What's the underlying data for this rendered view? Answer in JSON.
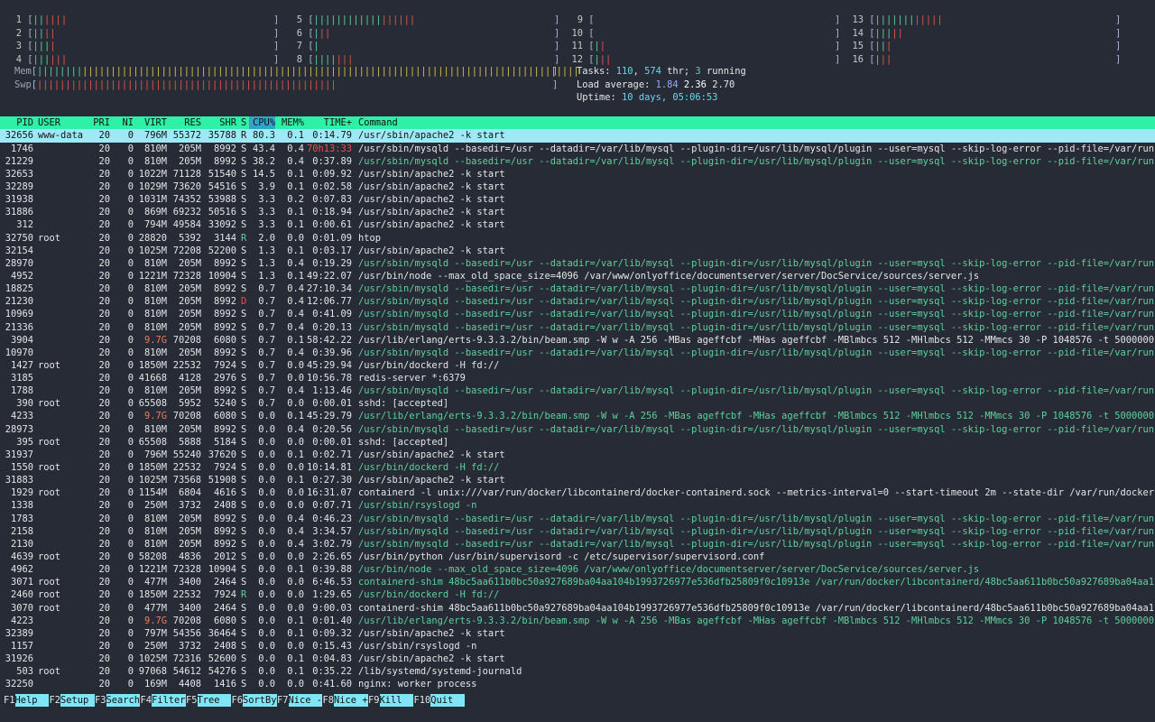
{
  "cpus": [
    {
      "id": "1",
      "green": "||",
      "red": "||||"
    },
    {
      "id": "2",
      "green": "||",
      "red": "||"
    },
    {
      "id": "3",
      "green": "|||",
      "red": "|"
    },
    {
      "id": "4",
      "green": "|||",
      "red": "|||"
    },
    {
      "id": "5",
      "green": "||||||||||||",
      "red": "||||||"
    },
    {
      "id": "6",
      "green": "|",
      "red": "||"
    },
    {
      "id": "7",
      "green": "|",
      "red": ""
    },
    {
      "id": "8",
      "green": "||||",
      "red": "|||"
    },
    {
      "id": "9",
      "green": "",
      "red": ""
    },
    {
      "id": "10",
      "green": "",
      "red": ""
    },
    {
      "id": "11",
      "green": "|",
      "red": "|"
    },
    {
      "id": "12",
      "green": "|",
      "red": "||"
    },
    {
      "id": "13",
      "green": "|||||||",
      "red": "|||||"
    },
    {
      "id": "14",
      "green": "|||",
      "red": "||"
    },
    {
      "id": "15",
      "green": "||",
      "red": "|"
    },
    {
      "id": "16",
      "green": "|",
      "red": "||"
    }
  ],
  "mem": {
    "label": "Mem",
    "green": "||||||||",
    "yellow": "||||||||||||||||||||||||||||||||||||||||||||||||||||||||||||||||||||||||||||||||||||||||"
  },
  "swp": {
    "label": "Swp",
    "red": "|||||||||||||||||||||||||||||||||||||||||||||||||||||"
  },
  "stats": {
    "tasks_label": "Tasks: ",
    "tasks": "110",
    "thr_sep": ", ",
    "thr": "574",
    "thr_label": " thr; ",
    "running": "3",
    "running_label": " running",
    "load_label": "Load average: ",
    "load1": "1.84",
    "load5": "2.36",
    "load15": "2.70",
    "uptime_label": "Uptime: ",
    "uptime": "10 days, 05:06:53"
  },
  "columns": {
    "pid": "PID",
    "user": "USER",
    "pri": "PRI",
    "ni": "NI",
    "virt": "VIRT",
    "res": "RES",
    "shr": "SHR",
    "s": "S",
    "cpu": "CPU%",
    "mem": "MEM%",
    "time": "TIME+",
    "cmd": "Command"
  },
  "processes": [
    {
      "pid": "32656",
      "user": "www-data",
      "pri": "20",
      "ni": "0",
      "virt": "796M",
      "res": "55372",
      "shr": "35788",
      "s": "R",
      "cpu": "80.3",
      "mem": "0.1",
      "time": "0:14.79",
      "cmd": "/usr/sbin/apache2 -k start",
      "sel": true
    },
    {
      "pid": "1746",
      "user": "",
      "pri": "20",
      "ni": "0",
      "virt": "810M",
      "res": "205M",
      "shr": "8992",
      "s": "S",
      "cpu": "43.4",
      "mem": "0.4",
      "time": "70h13:33",
      "cmd": "/usr/sbin/mysqld --basedir=/usr --datadir=/var/lib/mysql --plugin-dir=/usr/lib/mysql/plugin --user=mysql --skip-log-error --pid-file=/var/run"
    },
    {
      "pid": "21229",
      "user": "",
      "pri": "20",
      "ni": "0",
      "virt": "810M",
      "res": "205M",
      "shr": "8992",
      "s": "S",
      "cpu": "38.2",
      "mem": "0.4",
      "time": "0:37.89",
      "cmd": "/usr/sbin/mysqld --basedir=/usr --datadir=/var/lib/mysql --plugin-dir=/usr/lib/mysql/plugin --user=mysql --skip-log-error --pid-file=/var/run",
      "thread": true
    },
    {
      "pid": "32653",
      "user": "",
      "pri": "20",
      "ni": "0",
      "virt": "1022M",
      "res": "71128",
      "shr": "51540",
      "s": "S",
      "cpu": "14.5",
      "mem": "0.1",
      "time": "0:09.92",
      "cmd": "/usr/sbin/apache2 -k start"
    },
    {
      "pid": "32289",
      "user": "",
      "pri": "20",
      "ni": "0",
      "virt": "1029M",
      "res": "73620",
      "shr": "54516",
      "s": "S",
      "cpu": "3.9",
      "mem": "0.1",
      "time": "0:02.58",
      "cmd": "/usr/sbin/apache2 -k start"
    },
    {
      "pid": "31938",
      "user": "",
      "pri": "20",
      "ni": "0",
      "virt": "1031M",
      "res": "74352",
      "shr": "53988",
      "s": "S",
      "cpu": "3.3",
      "mem": "0.2",
      "time": "0:07.83",
      "cmd": "/usr/sbin/apache2 -k start"
    },
    {
      "pid": "31886",
      "user": "",
      "pri": "20",
      "ni": "0",
      "virt": "869M",
      "res": "69232",
      "shr": "50516",
      "s": "S",
      "cpu": "3.3",
      "mem": "0.1",
      "time": "0:18.94",
      "cmd": "/usr/sbin/apache2 -k start"
    },
    {
      "pid": "312",
      "user": "",
      "pri": "20",
      "ni": "0",
      "virt": "794M",
      "res": "49584",
      "shr": "33092",
      "s": "S",
      "cpu": "3.3",
      "mem": "0.1",
      "time": "0:00.61",
      "cmd": "/usr/sbin/apache2 -k start"
    },
    {
      "pid": "32750",
      "user": "root",
      "pri": "20",
      "ni": "0",
      "virt": "28820",
      "res": "5392",
      "shr": "3144",
      "s": "R",
      "cpu": "2.0",
      "mem": "0.0",
      "time": "0:01.09",
      "cmd": "htop"
    },
    {
      "pid": "32154",
      "user": "",
      "pri": "20",
      "ni": "0",
      "virt": "1025M",
      "res": "72208",
      "shr": "52200",
      "s": "S",
      "cpu": "1.3",
      "mem": "0.1",
      "time": "0:03.17",
      "cmd": "/usr/sbin/apache2 -k start"
    },
    {
      "pid": "28970",
      "user": "",
      "pri": "20",
      "ni": "0",
      "virt": "810M",
      "res": "205M",
      "shr": "8992",
      "s": "S",
      "cpu": "1.3",
      "mem": "0.4",
      "time": "0:19.29",
      "cmd": "/usr/sbin/mysqld --basedir=/usr --datadir=/var/lib/mysql --plugin-dir=/usr/lib/mysql/plugin --user=mysql --skip-log-error --pid-file=/var/run",
      "thread": true
    },
    {
      "pid": "4952",
      "user": "",
      "pri": "20",
      "ni": "0",
      "virt": "1221M",
      "res": "72328",
      "shr": "10904",
      "s": "S",
      "cpu": "1.3",
      "mem": "0.1",
      "time": "49:22.07",
      "cmd": "/usr/bin/node --max_old_space_size=4096 /var/www/onlyoffice/documentserver/server/DocService/sources/server.js"
    },
    {
      "pid": "18825",
      "user": "",
      "pri": "20",
      "ni": "0",
      "virt": "810M",
      "res": "205M",
      "shr": "8992",
      "s": "S",
      "cpu": "0.7",
      "mem": "0.4",
      "time": "27:10.34",
      "cmd": "/usr/sbin/mysqld --basedir=/usr --datadir=/var/lib/mysql --plugin-dir=/usr/lib/mysql/plugin --user=mysql --skip-log-error --pid-file=/var/run",
      "thread": true
    },
    {
      "pid": "21230",
      "user": "",
      "pri": "20",
      "ni": "0",
      "virt": "810M",
      "res": "205M",
      "shr": "8992",
      "s": "D",
      "cpu": "0.7",
      "mem": "0.4",
      "time": "12:06.77",
      "cmd": "/usr/sbin/mysqld --basedir=/usr --datadir=/var/lib/mysql --plugin-dir=/usr/lib/mysql/plugin --user=mysql --skip-log-error --pid-file=/var/run",
      "thread": true
    },
    {
      "pid": "10969",
      "user": "",
      "pri": "20",
      "ni": "0",
      "virt": "810M",
      "res": "205M",
      "shr": "8992",
      "s": "S",
      "cpu": "0.7",
      "mem": "0.4",
      "time": "0:41.09",
      "cmd": "/usr/sbin/mysqld --basedir=/usr --datadir=/var/lib/mysql --plugin-dir=/usr/lib/mysql/plugin --user=mysql --skip-log-error --pid-file=/var/run",
      "thread": true
    },
    {
      "pid": "21336",
      "user": "",
      "pri": "20",
      "ni": "0",
      "virt": "810M",
      "res": "205M",
      "shr": "8992",
      "s": "S",
      "cpu": "0.7",
      "mem": "0.4",
      "time": "0:20.13",
      "cmd": "/usr/sbin/mysqld --basedir=/usr --datadir=/var/lib/mysql --plugin-dir=/usr/lib/mysql/plugin --user=mysql --skip-log-error --pid-file=/var/run",
      "thread": true
    },
    {
      "pid": "3904",
      "user": "",
      "pri": "20",
      "ni": "0",
      "virt": "9.7G",
      "res": "70208",
      "shr": "6080",
      "s": "S",
      "cpu": "0.7",
      "mem": "0.1",
      "time": "58:42.22",
      "cmd": "/usr/lib/erlang/erts-9.3.3.2/bin/beam.smp -W w -A 256 -MBas ageffcbf -MHas ageffcbf -MBlmbcs 512 -MHlmbcs 512 -MMmcs 30 -P 1048576 -t 5000000"
    },
    {
      "pid": "10970",
      "user": "",
      "pri": "20",
      "ni": "0",
      "virt": "810M",
      "res": "205M",
      "shr": "8992",
      "s": "S",
      "cpu": "0.7",
      "mem": "0.4",
      "time": "0:39.96",
      "cmd": "/usr/sbin/mysqld --basedir=/usr --datadir=/var/lib/mysql --plugin-dir=/usr/lib/mysql/plugin --user=mysql --skip-log-error --pid-file=/var/run",
      "thread": true
    },
    {
      "pid": "1427",
      "user": "root",
      "pri": "20",
      "ni": "0",
      "virt": "1850M",
      "res": "22532",
      "shr": "7924",
      "s": "S",
      "cpu": "0.7",
      "mem": "0.0",
      "time": "45:29.94",
      "cmd": "/usr/bin/dockerd -H fd://"
    },
    {
      "pid": "3185",
      "user": "",
      "pri": "20",
      "ni": "0",
      "virt": "41668",
      "res": "4128",
      "shr": "2976",
      "s": "S",
      "cpu": "0.7",
      "mem": "0.0",
      "time": "10:56.78",
      "cmd": "redis-server *:6379"
    },
    {
      "pid": "1788",
      "user": "",
      "pri": "20",
      "ni": "0",
      "virt": "810M",
      "res": "205M",
      "shr": "8992",
      "s": "S",
      "cpu": "0.7",
      "mem": "0.4",
      "time": "1:13.46",
      "cmd": "/usr/sbin/mysqld --basedir=/usr --datadir=/var/lib/mysql --plugin-dir=/usr/lib/mysql/plugin --user=mysql --skip-log-error --pid-file=/var/run",
      "thread": true
    },
    {
      "pid": "390",
      "user": "root",
      "pri": "20",
      "ni": "0",
      "virt": "65508",
      "res": "5952",
      "shr": "5240",
      "s": "S",
      "cpu": "0.7",
      "mem": "0.0",
      "time": "0:00.01",
      "cmd": "sshd: [accepted]"
    },
    {
      "pid": "4233",
      "user": "",
      "pri": "20",
      "ni": "0",
      "virt": "9.7G",
      "res": "70208",
      "shr": "6080",
      "s": "S",
      "cpu": "0.0",
      "mem": "0.1",
      "time": "45:29.79",
      "cmd": "/usr/lib/erlang/erts-9.3.3.2/bin/beam.smp -W w -A 256 -MBas ageffcbf -MHas ageffcbf -MBlmbcs 512 -MHlmbcs 512 -MMmcs 30 -P 1048576 -t 5000000",
      "thread": true
    },
    {
      "pid": "28973",
      "user": "",
      "pri": "20",
      "ni": "0",
      "virt": "810M",
      "res": "205M",
      "shr": "8992",
      "s": "S",
      "cpu": "0.0",
      "mem": "0.4",
      "time": "0:20.56",
      "cmd": "/usr/sbin/mysqld --basedir=/usr --datadir=/var/lib/mysql --plugin-dir=/usr/lib/mysql/plugin --user=mysql --skip-log-error --pid-file=/var/run",
      "thread": true
    },
    {
      "pid": "395",
      "user": "root",
      "pri": "20",
      "ni": "0",
      "virt": "65508",
      "res": "5888",
      "shr": "5184",
      "s": "S",
      "cpu": "0.0",
      "mem": "0.0",
      "time": "0:00.01",
      "cmd": "sshd: [accepted]"
    },
    {
      "pid": "31937",
      "user": "",
      "pri": "20",
      "ni": "0",
      "virt": "796M",
      "res": "55240",
      "shr": "37620",
      "s": "S",
      "cpu": "0.0",
      "mem": "0.1",
      "time": "0:02.71",
      "cmd": "/usr/sbin/apache2 -k start"
    },
    {
      "pid": "1550",
      "user": "root",
      "pri": "20",
      "ni": "0",
      "virt": "1850M",
      "res": "22532",
      "shr": "7924",
      "s": "S",
      "cpu": "0.0",
      "mem": "0.0",
      "time": "10:14.81",
      "cmd": "/usr/bin/dockerd -H fd://",
      "thread": true
    },
    {
      "pid": "31883",
      "user": "",
      "pri": "20",
      "ni": "0",
      "virt": "1025M",
      "res": "73568",
      "shr": "51908",
      "s": "S",
      "cpu": "0.0",
      "mem": "0.1",
      "time": "0:27.30",
      "cmd": "/usr/sbin/apache2 -k start"
    },
    {
      "pid": "1929",
      "user": "root",
      "pri": "20",
      "ni": "0",
      "virt": "1154M",
      "res": "6804",
      "shr": "4616",
      "s": "S",
      "cpu": "0.0",
      "mem": "0.0",
      "time": "16:31.07",
      "cmd": "containerd -l unix:///var/run/docker/libcontainerd/docker-containerd.sock --metrics-interval=0 --start-timeout 2m --state-dir /var/run/docker"
    },
    {
      "pid": "1338",
      "user": "",
      "pri": "20",
      "ni": "0",
      "virt": "250M",
      "res": "3732",
      "shr": "2408",
      "s": "S",
      "cpu": "0.0",
      "mem": "0.0",
      "time": "0:07.71",
      "cmd": "/usr/sbin/rsyslogd -n",
      "thread": true
    },
    {
      "pid": "1783",
      "user": "",
      "pri": "20",
      "ni": "0",
      "virt": "810M",
      "res": "205M",
      "shr": "8992",
      "s": "S",
      "cpu": "0.0",
      "mem": "0.4",
      "time": "0:46.23",
      "cmd": "/usr/sbin/mysqld --basedir=/usr --datadir=/var/lib/mysql --plugin-dir=/usr/lib/mysql/plugin --user=mysql --skip-log-error --pid-file=/var/run",
      "thread": true
    },
    {
      "pid": "2158",
      "user": "",
      "pri": "20",
      "ni": "0",
      "virt": "810M",
      "res": "205M",
      "shr": "8992",
      "s": "S",
      "cpu": "0.0",
      "mem": "0.4",
      "time": "3:34.57",
      "cmd": "/usr/sbin/mysqld --basedir=/usr --datadir=/var/lib/mysql --plugin-dir=/usr/lib/mysql/plugin --user=mysql --skip-log-error --pid-file=/var/run",
      "thread": true
    },
    {
      "pid": "2130",
      "user": "",
      "pri": "20",
      "ni": "0",
      "virt": "810M",
      "res": "205M",
      "shr": "8992",
      "s": "S",
      "cpu": "0.0",
      "mem": "0.4",
      "time": "3:02.79",
      "cmd": "/usr/sbin/mysqld --basedir=/usr --datadir=/var/lib/mysql --plugin-dir=/usr/lib/mysql/plugin --user=mysql --skip-log-error --pid-file=/var/run",
      "thread": true
    },
    {
      "pid": "4639",
      "user": "root",
      "pri": "20",
      "ni": "0",
      "virt": "58208",
      "res": "4836",
      "shr": "2012",
      "s": "S",
      "cpu": "0.0",
      "mem": "0.0",
      "time": "2:26.65",
      "cmd": "/usr/bin/python /usr/bin/supervisord -c /etc/supervisor/supervisord.conf"
    },
    {
      "pid": "4962",
      "user": "",
      "pri": "20",
      "ni": "0",
      "virt": "1221M",
      "res": "72328",
      "shr": "10904",
      "s": "S",
      "cpu": "0.0",
      "mem": "0.1",
      "time": "0:39.88",
      "cmd": "/usr/bin/node --max_old_space_size=4096 /var/www/onlyoffice/documentserver/server/DocService/sources/server.js",
      "thread": true
    },
    {
      "pid": "3071",
      "user": "root",
      "pri": "20",
      "ni": "0",
      "virt": "477M",
      "res": "3400",
      "shr": "2464",
      "s": "S",
      "cpu": "0.0",
      "mem": "0.0",
      "time": "6:46.53",
      "cmd": "containerd-shim 48bc5aa611b0bc50a927689ba04aa104b1993726977e536dfb25809f0c10913e /var/run/docker/libcontainerd/48bc5aa611b0bc50a927689ba04aa1",
      "thread": true
    },
    {
      "pid": "2460",
      "user": "root",
      "pri": "20",
      "ni": "0",
      "virt": "1850M",
      "res": "22532",
      "shr": "7924",
      "s": "R",
      "cpu": "0.0",
      "mem": "0.0",
      "time": "1:29.65",
      "cmd": "/usr/bin/dockerd -H fd://",
      "thread": true
    },
    {
      "pid": "3070",
      "user": "root",
      "pri": "20",
      "ni": "0",
      "virt": "477M",
      "res": "3400",
      "shr": "2464",
      "s": "S",
      "cpu": "0.0",
      "mem": "0.0",
      "time": "9:00.03",
      "cmd": "containerd-shim 48bc5aa611b0bc50a927689ba04aa104b1993726977e536dfb25809f0c10913e /var/run/docker/libcontainerd/48bc5aa611b0bc50a927689ba04aa1"
    },
    {
      "pid": "4223",
      "user": "",
      "pri": "20",
      "ni": "0",
      "virt": "9.7G",
      "res": "70208",
      "shr": "6080",
      "s": "S",
      "cpu": "0.0",
      "mem": "0.1",
      "time": "0:01.40",
      "cmd": "/usr/lib/erlang/erts-9.3.3.2/bin/beam.smp -W w -A 256 -MBas ageffcbf -MHas ageffcbf -MBlmbcs 512 -MHlmbcs 512 -MMmcs 30 -P 1048576 -t 5000000",
      "thread": true
    },
    {
      "pid": "32389",
      "user": "",
      "pri": "20",
      "ni": "0",
      "virt": "797M",
      "res": "54356",
      "shr": "36464",
      "s": "S",
      "cpu": "0.0",
      "mem": "0.1",
      "time": "0:09.32",
      "cmd": "/usr/sbin/apache2 -k start"
    },
    {
      "pid": "1157",
      "user": "",
      "pri": "20",
      "ni": "0",
      "virt": "250M",
      "res": "3732",
      "shr": "2408",
      "s": "S",
      "cpu": "0.0",
      "mem": "0.0",
      "time": "0:15.43",
      "cmd": "/usr/sbin/rsyslogd -n"
    },
    {
      "pid": "31926",
      "user": "",
      "pri": "20",
      "ni": "0",
      "virt": "1025M",
      "res": "72316",
      "shr": "52600",
      "s": "S",
      "cpu": "0.0",
      "mem": "0.1",
      "time": "0:04.83",
      "cmd": "/usr/sbin/apache2 -k start"
    },
    {
      "pid": "503",
      "user": "root",
      "pri": "20",
      "ni": "0",
      "virt": "97068",
      "res": "54612",
      "shr": "54276",
      "s": "S",
      "cpu": "0.0",
      "mem": "0.1",
      "time": "0:35.22",
      "cmd": "/lib/systemd/systemd-journald"
    },
    {
      "pid": "32250",
      "user": "",
      "pri": "20",
      "ni": "0",
      "virt": "169M",
      "res": "4408",
      "shr": "1416",
      "s": "S",
      "cpu": "0.0",
      "mem": "0.0",
      "time": "0:41.60",
      "cmd": "nginx: worker process"
    }
  ],
  "footer": [
    {
      "key": "F1",
      "label": "Help  "
    },
    {
      "key": "F2",
      "label": "Setup "
    },
    {
      "key": "F3",
      "label": "Search"
    },
    {
      "key": "F4",
      "label": "Filter"
    },
    {
      "key": "F5",
      "label": "Tree  "
    },
    {
      "key": "F6",
      "label": "SortBy"
    },
    {
      "key": "F7",
      "label": "Nice -"
    },
    {
      "key": "F8",
      "label": "Nice +"
    },
    {
      "key": "F9",
      "label": "Kill  "
    },
    {
      "key": "F10",
      "label": "Quit  "
    }
  ],
  "colors": {
    "background": "#272b36",
    "header": "#2ef0a7",
    "selection": "#9ee9f6",
    "thread": "#5ed19b",
    "red": "#e5534b",
    "blue": "#9aa7ff",
    "cyan": "#66d9e8"
  }
}
